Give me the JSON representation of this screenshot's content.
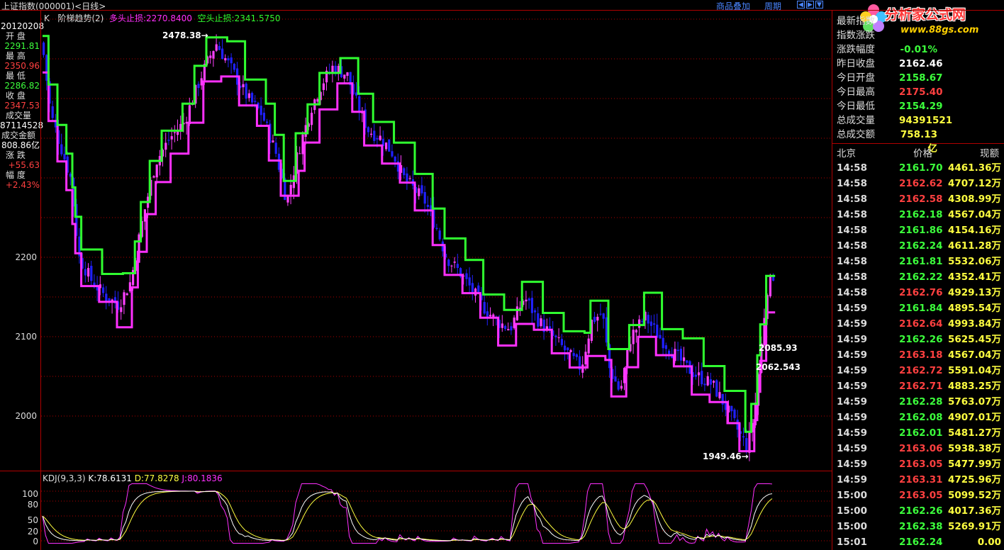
{
  "header": {
    "title": "上证指数(000001)<日线>",
    "links": [
      "商品叠加",
      "周期"
    ],
    "nav": [
      "◀",
      "▶",
      "▼"
    ]
  },
  "logo": {
    "brand": "分析家公式网",
    "url": "www.88gs.com"
  },
  "indicator": {
    "k_label": "K",
    "name": "阶梯趋势(2)",
    "long_stop": "多头止损:2270.8400",
    "short_stop": "空头止损:2341.5750"
  },
  "left_panel": {
    "date": "20120208",
    "rows": [
      {
        "label": "开  盘",
        "value": "2291.81",
        "color": "green"
      },
      {
        "label": "最  高",
        "value": "2350.96",
        "color": "red"
      },
      {
        "label": "最  低",
        "value": "2286.82",
        "color": "green"
      },
      {
        "label": "收  盘",
        "value": "2347.53",
        "color": "red"
      },
      {
        "label": "成交量",
        "value": "87114528",
        "color": "white"
      },
      {
        "label": "成交金额",
        "value": "808.86亿",
        "color": "white"
      },
      {
        "label": "涨  跌",
        "value": "+55.63",
        "color": "red"
      },
      {
        "label": "幅  度",
        "value": "+2.43%",
        "color": "red"
      }
    ]
  },
  "y_axis": {
    "ticks": [
      "2200",
      "2100",
      "2000"
    ]
  },
  "annotations": {
    "high": "2478.38→",
    "low": "1949.46→",
    "right1": "2085.93",
    "right2": "2062.543"
  },
  "kdj": {
    "label": "KDJ(9,3,3)",
    "k": "K:78.6131",
    "d": "D:77.8278",
    "j": "J:80.1836",
    "ticks": [
      "100",
      "80",
      "50",
      "20",
      "0"
    ]
  },
  "info_panel": {
    "rows": [
      {
        "label": "最新指数",
        "value": "",
        "color": "white"
      },
      {
        "label": "指数涨跌",
        "value": "",
        "color": "white"
      },
      {
        "label": "涨跌幅度",
        "value": "-0.01%",
        "color": "green"
      },
      {
        "label": "昨日收盘",
        "value": "2162.46",
        "color": "white"
      },
      {
        "label": "今日开盘",
        "value": "2158.67",
        "color": "green"
      },
      {
        "label": "今日最高",
        "value": "2175.40",
        "color": "red"
      },
      {
        "label": "今日最低",
        "value": "2154.29",
        "color": "green"
      },
      {
        "label": "总成交量",
        "value": "94391521",
        "color": "yellow"
      },
      {
        "label": "总成交额",
        "value": "758.13亿",
        "color": "yellow"
      }
    ]
  },
  "trades_header": {
    "time": "北京",
    "price": "价格",
    "volume": "现额"
  },
  "trades": [
    {
      "time": "14:58",
      "price": "2161.70",
      "color": "green",
      "amount": "4461.36万"
    },
    {
      "time": "14:58",
      "price": "2162.62",
      "color": "red",
      "amount": "4707.12万"
    },
    {
      "time": "14:58",
      "price": "2162.58",
      "color": "red",
      "amount": "4308.99万"
    },
    {
      "time": "14:58",
      "price": "2162.18",
      "color": "green",
      "amount": "4567.04万"
    },
    {
      "time": "14:58",
      "price": "2161.86",
      "color": "green",
      "amount": "4154.16万"
    },
    {
      "time": "14:58",
      "price": "2162.24",
      "color": "green",
      "amount": "4611.28万"
    },
    {
      "time": "14:58",
      "price": "2161.81",
      "color": "green",
      "amount": "5532.06万"
    },
    {
      "time": "14:58",
      "price": "2162.22",
      "color": "green",
      "amount": "4352.41万"
    },
    {
      "time": "14:58",
      "price": "2162.76",
      "color": "red",
      "amount": "4929.13万"
    },
    {
      "time": "14:59",
      "price": "2161.84",
      "color": "green",
      "amount": "4895.54万"
    },
    {
      "time": "14:59",
      "price": "2162.64",
      "color": "red",
      "amount": "4993.84万"
    },
    {
      "time": "14:59",
      "price": "2162.26",
      "color": "green",
      "amount": "5625.45万"
    },
    {
      "time": "14:59",
      "price": "2163.18",
      "color": "red",
      "amount": "4567.04万"
    },
    {
      "time": "14:59",
      "price": "2162.72",
      "color": "red",
      "amount": "5591.04万"
    },
    {
      "time": "14:59",
      "price": "2162.71",
      "color": "red",
      "amount": "4883.25万"
    },
    {
      "time": "14:59",
      "price": "2162.28",
      "color": "green",
      "amount": "5763.07万"
    },
    {
      "time": "14:59",
      "price": "2162.08",
      "color": "green",
      "amount": "4907.01万"
    },
    {
      "time": "14:59",
      "price": "2162.01",
      "color": "green",
      "amount": "5481.27万"
    },
    {
      "time": "14:59",
      "price": "2163.06",
      "color": "red",
      "amount": "5938.38万"
    },
    {
      "time": "14:59",
      "price": "2163.05",
      "color": "red",
      "amount": "5477.99万"
    },
    {
      "time": "14:59",
      "price": "2163.31",
      "color": "red",
      "amount": "4725.96万"
    },
    {
      "time": "15:00",
      "price": "2163.05",
      "color": "red",
      "amount": "5099.52万"
    },
    {
      "time": "15:00",
      "price": "2162.26",
      "color": "green",
      "amount": "4017.36万"
    },
    {
      "time": "15:00",
      "price": "2162.38",
      "color": "green",
      "amount": "5269.91万"
    },
    {
      "time": "15:01",
      "price": "2162.24",
      "color": "green",
      "amount": "0.00"
    }
  ],
  "colors": {
    "up_candle": "#ff40ff",
    "down_candle": "#2020ff",
    "long_stop_line": "#ff30ff",
    "short_stop_line": "#30ff30",
    "grid": "#b00000",
    "k_line": "#ffffff",
    "d_line": "#ffff40",
    "j_line": "#ff30ff"
  }
}
